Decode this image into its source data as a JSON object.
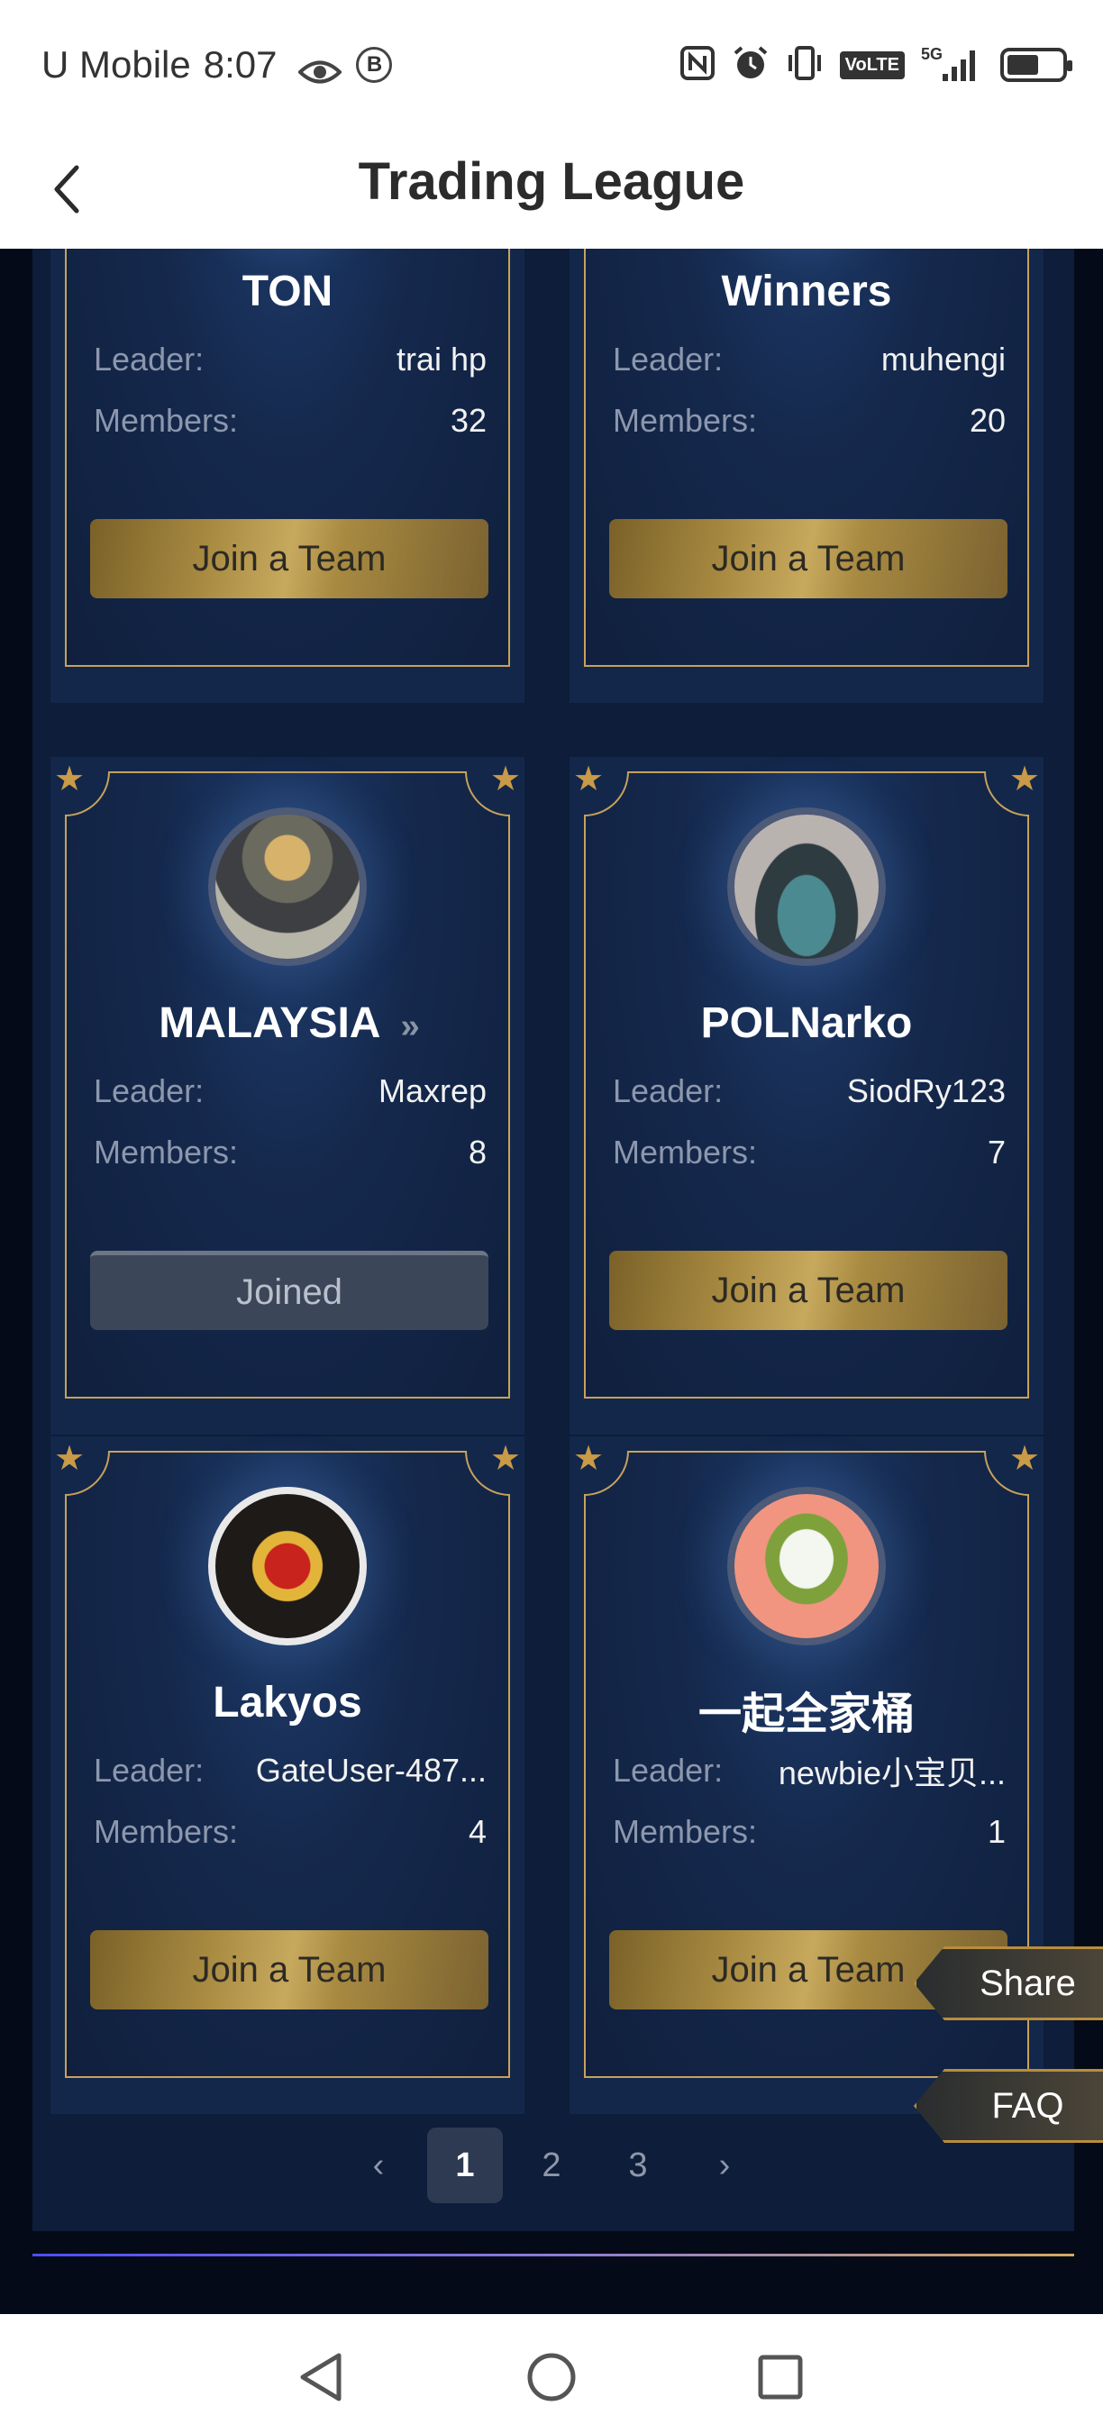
{
  "status_bar": {
    "carrier": "U Mobile",
    "time": "8:07",
    "b_badge": "B",
    "network": "5G",
    "volte": "VoLTE",
    "icons": [
      "eye-icon",
      "nfc-icon",
      "alarm-icon",
      "vibrate-icon",
      "volte-icon",
      "signal-icon",
      "battery-icon"
    ]
  },
  "header": {
    "title": "Trading League",
    "back_icon": "chevron-left-icon"
  },
  "labels": {
    "leader": "Leader:",
    "members": "Members:",
    "join": "Join a Team",
    "joined": "Joined"
  },
  "teams": [
    {
      "name": "TON",
      "leader": "trai hp",
      "members": "32",
      "status": "join"
    },
    {
      "name": "Winners",
      "leader": "muhengi",
      "members": "20",
      "status": "join"
    },
    {
      "name": "MALAYSIA",
      "leader": "Maxrep",
      "members": "8",
      "status": "joined",
      "chevron": "››"
    },
    {
      "name": "POLNarko",
      "leader": "SiodRy123",
      "members": "7",
      "status": "join"
    },
    {
      "name": "Lakyos",
      "leader": "GateUser-487...",
      "members": "4",
      "status": "join"
    },
    {
      "name": "一起全家桶",
      "leader": "newbie小宝贝...",
      "members": "1",
      "status": "join"
    }
  ],
  "pagination": {
    "prev": "‹",
    "pages": [
      "1",
      "2",
      "3"
    ],
    "current": "1",
    "next": "›"
  },
  "floating": {
    "share": "Share",
    "faq": "FAQ"
  },
  "nav": {
    "icons": [
      "back-triangle-icon",
      "home-circle-icon",
      "recents-square-icon"
    ]
  },
  "colors": {
    "gold": "#c7a15c",
    "panel": "#0d1d3a",
    "card": "#13274a"
  }
}
